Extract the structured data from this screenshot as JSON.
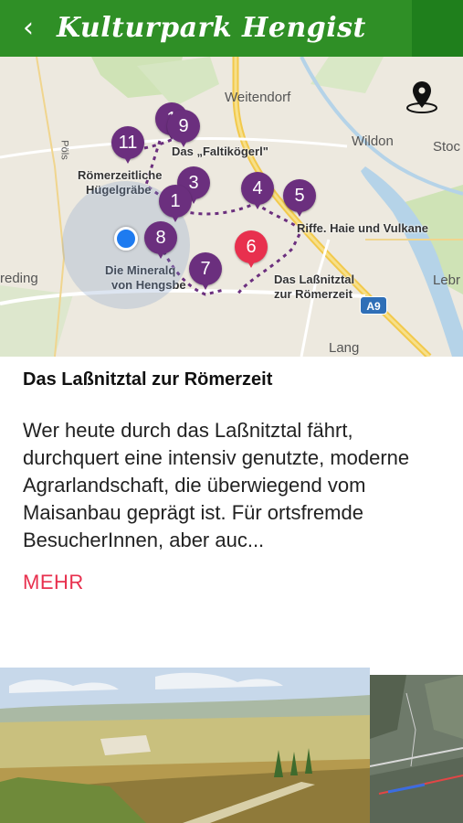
{
  "header": {
    "title": "Kulturpark Hengist",
    "back_icon": "chevron-left-icon",
    "background": "#2f8f26"
  },
  "map": {
    "places": {
      "weitendorf": "Weitendorf",
      "wildon": "Wildon",
      "stoc": "Stoc",
      "pols": "Pöls",
      "lebr": "Lebr",
      "lang": "Lang",
      "preding": "reding"
    },
    "poi_labels": {
      "faltikoegerl": "Das „Faltikögerl\"",
      "roemer_1": "Römerzeitliche",
      "roemer_2": "Hügelgräbe",
      "riffe": "Riffe. Haie und Vulkane",
      "mineral_1": "Die Mineralq",
      "mineral_2": "von Hengsbe",
      "lassnitz_1": "Das Laßnitztal",
      "lassnitz_2": "zur Römerzeit"
    },
    "road_shield": "A9",
    "markers": [
      "1",
      "3",
      "4",
      "5",
      "6",
      "7",
      "8",
      "9",
      "11",
      "1"
    ],
    "active_marker": "6",
    "marker_color": "#6b2f7e",
    "active_color": "#e8304e",
    "location_icon": "map-pin-icon"
  },
  "detail": {
    "title": "Das Laßnitztal zur Römerzeit",
    "description": "Wer heute durch das Laßnitztal fährt, durchquert eine intensiv genutzte, moderne Agrarlandschaft, die überwiegend vom Maisanbau geprägt ist. Für ortsfremde BesucherInnen, aber auc...",
    "more_label": "MEHR",
    "more_color": "#e8304e"
  }
}
